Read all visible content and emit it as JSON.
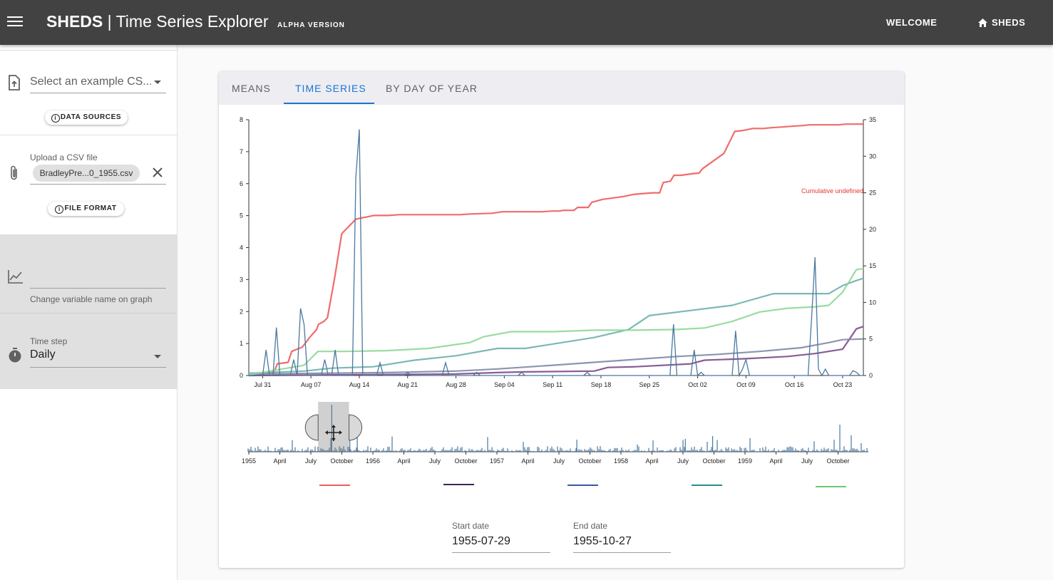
{
  "appbar": {
    "brand": "SHEDS",
    "separator": "|",
    "title": "Time Series Explorer",
    "badge": "ALPHA VERSION",
    "welcome_label": "WELCOME",
    "sheds_label": "SHEDS"
  },
  "sidebar": {
    "example_select_placeholder": "Select an example CS...",
    "data_sources_label": "DATA SOURCES",
    "upload_label": "Upload a CSV file",
    "uploaded_file": "BradleyPre...0_1955.csv",
    "file_format_label": "FILE FORMAT",
    "variable_name_value": "",
    "variable_name_help": "Change variable name on graph",
    "timestep_label": "Time step",
    "timestep_value": "Daily"
  },
  "tabs": [
    {
      "label": "MEANS",
      "active": false
    },
    {
      "label": "TIME SERIES",
      "active": true
    },
    {
      "label": "BY DAY OF YEAR",
      "active": false
    }
  ],
  "dates": {
    "start_label": "Start date",
    "start_value": "1955-07-29",
    "end_label": "End date",
    "end_value": "1955-10-27"
  },
  "colors": {
    "appbar": "#424242",
    "accent": "#1976d2",
    "daily": "#4a78a0",
    "cumulative": "#ef5b5b",
    "purple": "#7b4a8a",
    "slate": "#7f8aa6",
    "teal": "#6db0ae",
    "green": "#8ed898"
  },
  "chart_data": {
    "type": "line",
    "x_tick_labels": [
      "Jul 31",
      "Aug 07",
      "Aug 14",
      "Aug 21",
      "Aug 28",
      "Sep 04",
      "Sep 11",
      "Sep 18",
      "Sep 25",
      "Oct 02",
      "Oct 09",
      "Oct 16",
      "Oct 23"
    ],
    "y_left_ticks": [
      "0",
      "1",
      "2",
      "3",
      "4",
      "5",
      "6",
      "7",
      "8"
    ],
    "y_right_ticks": [
      "0",
      "5",
      "10",
      "15",
      "20",
      "25",
      "30",
      "35"
    ],
    "ylim_left": [
      0,
      8
    ],
    "ylim_right": [
      0,
      35
    ],
    "cumulative_label": "Cumulative undefined",
    "x_range_days": [
      0,
      89
    ],
    "daily_series": {
      "axis": "left",
      "x_day": [
        0,
        1,
        2,
        3,
        4,
        5,
        6,
        7,
        8,
        9,
        10,
        11,
        12,
        13,
        14,
        15,
        16,
        17,
        18,
        19,
        20,
        21,
        22,
        23,
        24,
        25,
        26,
        27,
        28,
        29,
        30,
        31,
        32,
        33,
        34,
        35,
        36,
        37,
        38,
        39,
        40,
        41,
        42,
        43,
        44,
        45,
        46,
        47,
        48,
        49,
        50,
        51,
        52,
        53,
        54,
        55,
        56,
        57,
        58,
        59,
        60,
        61,
        62,
        63,
        64,
        65,
        66,
        67,
        68,
        69,
        70,
        71,
        72,
        73,
        74,
        75,
        76,
        77,
        78,
        79,
        80,
        81,
        82,
        83,
        84,
        85,
        86,
        87,
        88
      ],
      "values": [
        0,
        0,
        0,
        0,
        0,
        0.8,
        0,
        0,
        1.5,
        0,
        0,
        0,
        0,
        0.5,
        0,
        2.1,
        1.6,
        0,
        0,
        0,
        0,
        0,
        0.5,
        0,
        0,
        0.8,
        0,
        0,
        0,
        0,
        0,
        6.2,
        7.7,
        0,
        0,
        0,
        0,
        0,
        0.4,
        0,
        0,
        0,
        0,
        0,
        0,
        0,
        0.1,
        0,
        0,
        0,
        0,
        0,
        0,
        0,
        0,
        0,
        0,
        0.4,
        0,
        0,
        0,
        0,
        0,
        0,
        0,
        0,
        0.1,
        0,
        0,
        0,
        0,
        0,
        0,
        0,
        0,
        0,
        0,
        0,
        0,
        0.1,
        0,
        0,
        0,
        0,
        0,
        0,
        0,
        0,
        0,
        0,
        0,
        0,
        0,
        0,
        0,
        0,
        0,
        0,
        0.1,
        0,
        0,
        0,
        0,
        0,
        0,
        0,
        0,
        0,
        0,
        0,
        0,
        0,
        0,
        0,
        0,
        0,
        0,
        0,
        0,
        0,
        0,
        0,
        0,
        1.6,
        0,
        0,
        0,
        0,
        0,
        0.8,
        0,
        0.1,
        0,
        0,
        0,
        0,
        0,
        0,
        0,
        0,
        0,
        1.4,
        0,
        0.2,
        0.5,
        0,
        0,
        0,
        0,
        0,
        0,
        0,
        0,
        0,
        0,
        0,
        0,
        0,
        0,
        0,
        0,
        0,
        0,
        1.8,
        3.7,
        0.2,
        0,
        0.2,
        0,
        0,
        0,
        0,
        0,
        0,
        0,
        0.15,
        0.1,
        0,
        0
      ]
    },
    "series": [
      {
        "name": "",
        "axis": "right",
        "color": "#ef5b5b",
        "x_day": [
          0,
          5,
          7,
          8,
          11,
          12,
          15,
          17,
          19,
          19.5,
          21,
          22,
          24,
          26,
          30,
          35,
          39,
          42,
          47,
          52,
          59,
          62,
          68,
          71,
          77,
          82,
          85,
          87,
          88,
          91,
          92,
          95,
          96,
          99,
          105,
          107,
          108,
          113,
          115,
          116,
          118,
          119,
          121,
          124,
          126,
          127,
          133,
          136,
          138,
          139,
          141,
          144,
          146,
          149,
          152,
          155,
          157,
          158,
          160,
          162,
          165,
          167,
          171,
          172
        ],
        "values": [
          0,
          0.3,
          0.4,
          1.6,
          1.8,
          3.3,
          3.9,
          5.2,
          6.3,
          7.0,
          7.4,
          7.9,
          13.3,
          19.4,
          21.4,
          21.9,
          21.9,
          22.0,
          22.0,
          22.0,
          22.0,
          22.1,
          22.2,
          22.4,
          22.4,
          22.4,
          22.5,
          22.5,
          22.6,
          22.6,
          23.0,
          23.0,
          23.7,
          24.1,
          24.5,
          24.7,
          24.8,
          25.0,
          25.0,
          26.4,
          26.6,
          27.4,
          27.4,
          27.6,
          27.7,
          28.3,
          30.4,
          33.4,
          33.5,
          33.6,
          33.8,
          33.8,
          33.9,
          34.0,
          34.1,
          34.2,
          34.3,
          34.3,
          34.3,
          34.3,
          34.3,
          34.4,
          34.4,
          34.4
        ]
      },
      {
        "name": "",
        "axis": "right",
        "color": "#7b4a8a",
        "x_day": [
          0,
          30,
          36,
          40,
          50,
          52,
          56,
          64,
          66,
          72,
          78,
          82,
          86,
          88,
          89
        ],
        "values": [
          0.0,
          0.2,
          0.4,
          0.5,
          0.6,
          1.1,
          1.2,
          1.6,
          2.1,
          2.3,
          2.6,
          3.0,
          3.6,
          6.4,
          6.7
        ]
      },
      {
        "name": "",
        "axis": "right",
        "color": "#7f8aa6",
        "x_day": [
          0,
          10,
          20,
          30,
          36,
          44,
          50,
          56,
          62,
          68,
          74,
          80,
          84,
          86,
          89
        ],
        "values": [
          0.2,
          0.3,
          0.4,
          0.6,
          0.9,
          1.4,
          1.8,
          2.2,
          2.6,
          2.9,
          3.3,
          3.8,
          4.5,
          4.9,
          5.0
        ]
      },
      {
        "name": "",
        "axis": "right",
        "color": "#6db0ae",
        "x_day": [
          0,
          8,
          12,
          18,
          24,
          30,
          36,
          40,
          46,
          50,
          55,
          58,
          64,
          70,
          76,
          82,
          84,
          86,
          88,
          89
        ],
        "values": [
          0.3,
          0.6,
          1.0,
          1.2,
          2.1,
          2.7,
          3.7,
          3.7,
          4.6,
          5.2,
          6.3,
          8.2,
          8.9,
          9.6,
          11.2,
          11.2,
          11.2,
          12.3,
          13.0,
          13.3
        ]
      },
      {
        "name": "",
        "axis": "right",
        "color": "#8ed898",
        "x_day": [
          0,
          8,
          10,
          14,
          20,
          26,
          32,
          34,
          38,
          44,
          50,
          56,
          62,
          66,
          70,
          74,
          78,
          82,
          84,
          86,
          88,
          89
        ],
        "values": [
          0.1,
          1.4,
          3.3,
          3.3,
          3.4,
          3.7,
          4.5,
          5.3,
          6.0,
          6.0,
          6.2,
          6.2,
          6.3,
          6.5,
          7.4,
          8.7,
          9.2,
          9.4,
          9.6,
          11.4,
          14.5,
          14.6
        ]
      }
    ]
  },
  "navigator": {
    "tick_labels": [
      "1955",
      "April",
      "July",
      "October",
      "1956",
      "April",
      "July",
      "October",
      "1957",
      "April",
      "July",
      "October",
      "1958",
      "April",
      "July",
      "October",
      "1959",
      "April",
      "July",
      "October"
    ],
    "selection_from_day": 206,
    "selection_to_day": 297,
    "total_days": 1825
  },
  "legend": [
    {
      "color": "#ef5b5b",
      "label": ""
    },
    {
      "color": "#3f2357",
      "label": ""
    },
    {
      "color": "#3a5a9c",
      "label": ""
    },
    {
      "color": "#2a8a8a",
      "label": ""
    },
    {
      "color": "#6cc872",
      "label": ""
    }
  ]
}
